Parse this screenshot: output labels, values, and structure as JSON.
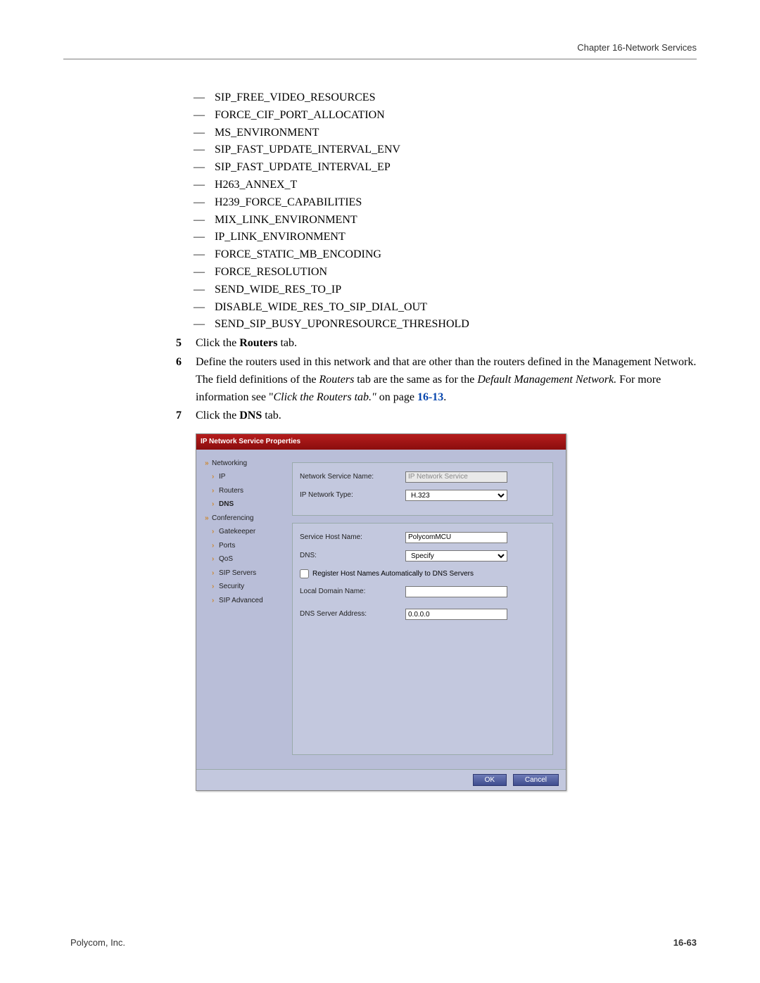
{
  "header": {
    "chapter": "Chapter 16-Network Services"
  },
  "flags": [
    "SIP_FREE_VIDEO_RESOURCES",
    "FORCE_CIF_PORT_ALLOCATION",
    "MS_ENVIRONMENT",
    "SIP_FAST_UPDATE_INTERVAL_ENV",
    "SIP_FAST_UPDATE_INTERVAL_EP",
    "H263_ANNEX_T",
    "H239_FORCE_CAPABILITIES",
    "MIX_LINK_ENVIRONMENT",
    "IP_LINK_ENVIRONMENT",
    "FORCE_STATIC_MB_ENCODING",
    "FORCE_RESOLUTION",
    "SEND_WIDE_RES_TO_IP",
    "DISABLE_WIDE_RES_TO_SIP_DIAL_OUT",
    "SEND_SIP_BUSY_UPONRESOURCE_THRESHOLD"
  ],
  "steps": {
    "s5": {
      "num": "5",
      "pre": "Click the ",
      "bold": "Routers",
      "post": " tab."
    },
    "s6": {
      "num": "6",
      "t1": "Define the routers used in this network and that are other than the routers defined in the Management Network. The field definitions of the ",
      "it1": "Routers",
      "t2": " tab are the same as for the ",
      "it2": "Default Management Network.",
      "t3": " For more information see \"",
      "it3": "Click the Routers tab.\"",
      "t4": " on page ",
      "link": "16-13",
      "t5": "."
    },
    "s7": {
      "num": "7",
      "pre": "Click the ",
      "bold": "DNS",
      "post": " tab."
    }
  },
  "dialog": {
    "title": "IP Network Service Properties",
    "nav": {
      "g1": "Networking",
      "items1": [
        "IP",
        "Routers",
        "DNS"
      ],
      "g2": "Conferencing",
      "items2": [
        "Gatekeeper",
        "Ports",
        "QoS",
        "SIP Servers",
        "Security",
        "SIP Advanced"
      ],
      "selected": "DNS"
    },
    "fields": {
      "nsn_label": "Network Service Name:",
      "nsn_value": "IP Network Service",
      "type_label": "IP Network Type:",
      "type_value": "H.323",
      "host_label": "Service Host Name:",
      "host_value": "PolycomMCU",
      "dns_label": "DNS:",
      "dns_value": "Specify",
      "reg_label": "Register Host Names Automatically to DNS Servers",
      "domain_label": "Local Domain Name:",
      "domain_value": "",
      "server_label": "DNS Server Address:",
      "server_value": "0.0.0.0"
    },
    "buttons": {
      "ok": "OK",
      "cancel": "Cancel"
    }
  },
  "footer": {
    "company": "Polycom, Inc.",
    "pagenum": "16-63"
  }
}
